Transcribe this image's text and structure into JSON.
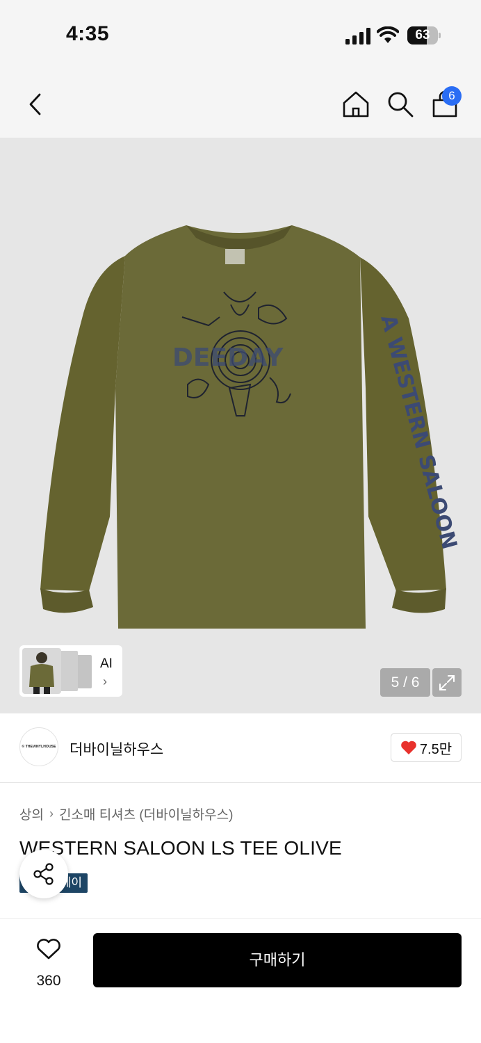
{
  "status_bar": {
    "time": "4:35",
    "battery_level": "63",
    "battery_fraction": 0.63
  },
  "nav": {
    "cart_count": "6",
    "icons": [
      "back-icon",
      "home-icon",
      "search-icon",
      "cart-icon"
    ]
  },
  "gallery": {
    "counter": "5 / 6",
    "ai_label": "AI",
    "sleeve_print": "A WESTERN SALOON",
    "chest_print": "DEEDAY"
  },
  "brand": {
    "name": "더바이닐하우스",
    "logo_text": "© THEVINYLHOUSE",
    "likes": "7.5만"
  },
  "product": {
    "breadcrumb": [
      "상의",
      "긴소매 티셔츠 (더바이닐하우스)"
    ],
    "title": "WESTERN SALOON LS TEE OLIVE",
    "tag": "페이"
  },
  "bottom_bar": {
    "wish_count": "360",
    "buy_label": "구매하기"
  },
  "colors": {
    "accent_badge": "#2a6df4",
    "heart": "#e8312c",
    "shirt": "#6b6a38",
    "tag_bg": "#1d4565"
  }
}
